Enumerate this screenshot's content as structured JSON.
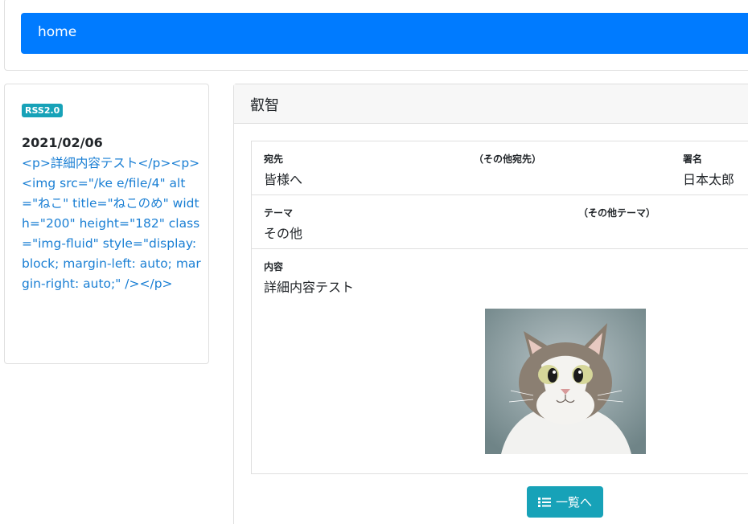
{
  "nav": {
    "home_label": "home"
  },
  "sidebar": {
    "badge": "RSS2.0",
    "date": "2021/02/06",
    "entry_text": "<p>詳細内容テスト</p><p><img src=\"/ke        e/file/4\" alt=\"ねこ\" title=\"ねこのめ\" width=\"200\" height=\"182\" class=\"img-fluid\" style=\"display: block; margin-left: auto; margin-right: auto;\" /></p>"
  },
  "main": {
    "header": "叡智",
    "fields": {
      "to_label": "宛先",
      "to_value": "皆様へ",
      "other_to_label": "（その他宛先）",
      "sign_label": "署名",
      "sign_value": "日本太郎",
      "theme_label": "テーマ",
      "theme_value": "その他",
      "other_theme_label": "（その他テーマ）",
      "content_label": "内容",
      "content_value": "詳細内容テスト"
    },
    "list_button": "一覧へ"
  },
  "colors": {
    "primary": "#007bff",
    "info": "#17a2b8",
    "link": "#1a7fd4",
    "border": "#dfdfdf"
  },
  "icons": [
    "list-icon"
  ]
}
